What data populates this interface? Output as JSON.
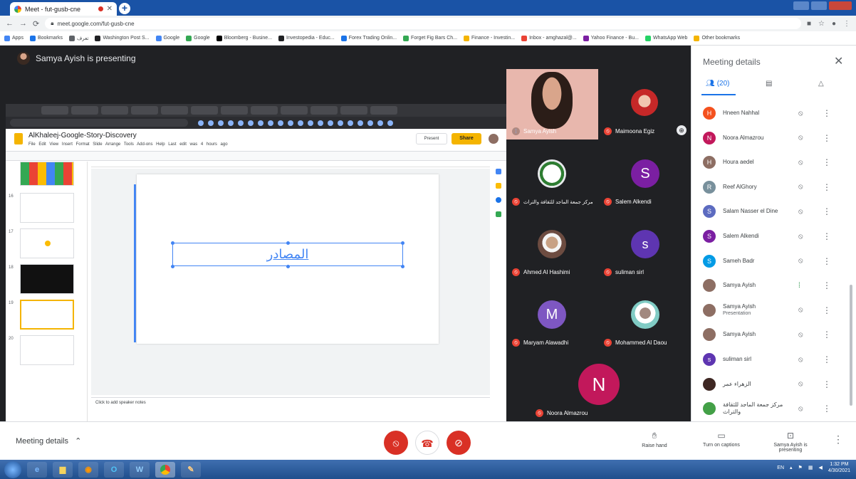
{
  "browser": {
    "tab_title": "Meet - fut-gusb-cne",
    "url": "meet.google.com/fut-gusb-cne",
    "bookmarks": [
      {
        "label": "Apps",
        "color": "#4285f4"
      },
      {
        "label": "Bookmarks",
        "color": "#1a73e8"
      },
      {
        "label": "تعرف",
        "color": "#5f6368"
      },
      {
        "label": "Washington Post S...",
        "color": "#202124"
      },
      {
        "label": "Google",
        "color": "#4285f4"
      },
      {
        "label": "Google",
        "color": "#34a853"
      },
      {
        "label": "Bloomberg - Busine...",
        "color": "#000000"
      },
      {
        "label": "Investopedia - Educ...",
        "color": "#202124"
      },
      {
        "label": "Forex Trading Onlin...",
        "color": "#1a73e8"
      },
      {
        "label": "Forget Fig Bars Ch...",
        "color": "#34a853"
      },
      {
        "label": "Finance - Investin...",
        "color": "#f4b400"
      },
      {
        "label": "Inbox - amghazal@...",
        "color": "#ea4335"
      },
      {
        "label": "Yahoo Finance - Bu...",
        "color": "#7b1fa2"
      },
      {
        "label": "WhatsApp Web",
        "color": "#25d366"
      },
      {
        "label": "Other bookmarks",
        "color": "#f4b400"
      }
    ]
  },
  "meet": {
    "presenting_label": "Samya Ayish is presenting",
    "shared_doc": {
      "title": "AlKhaleej-Google-Story-Discovery",
      "menu": "File  Edit  View  Insert  Format  Slide  Arrange  Tools  Add-ons  Help  Last edit was 4 hours ago",
      "present_label": "Present",
      "share_label": "Share",
      "slide_text": "المصادر",
      "notes_placeholder": "Click to add speaker notes",
      "slide_numbers": [
        "16",
        "17",
        "18",
        "19",
        "20"
      ]
    },
    "tiles": [
      {
        "name": "Samya Ayish",
        "type": "video"
      },
      {
        "name": "Maimoona Egiz",
        "type": "photo"
      },
      {
        "name": "مركز جمعة الماجد للثقافة والتراث",
        "type": "logo"
      },
      {
        "name": "Salem Alkendi",
        "type": "initial",
        "initial": "S",
        "color": "#7b1fa2"
      },
      {
        "name": "Ahmed Al Hashimi",
        "type": "photo"
      },
      {
        "name": "suliman sirl",
        "type": "initial",
        "initial": "s",
        "color": "#5e35b1"
      },
      {
        "name": "Maryam Alawadhi",
        "type": "initial",
        "initial": "M",
        "color": "#7e57c2"
      },
      {
        "name": "Mohammed Al Daou",
        "type": "photo"
      },
      {
        "name": "Noora Almazrou",
        "type": "initial",
        "initial": "N",
        "color": "#c2185b"
      }
    ]
  },
  "panel": {
    "title": "Meeting details",
    "people_tab_label": "(20)",
    "participants": [
      {
        "name": "Hneen Nahhal",
        "initial": "H",
        "color": "#f4511e"
      },
      {
        "name": "Noora Almazrou",
        "initial": "N",
        "color": "#c2185b"
      },
      {
        "name": "Houra aedel",
        "initial": "H",
        "color": "#8d6e63"
      },
      {
        "name": "Reef AlGhory",
        "initial": "R",
        "color": "#78909c"
      },
      {
        "name": "Salam Nasser el Dine",
        "initial": "S",
        "color": "#5c6bc0"
      },
      {
        "name": "Salem Alkendi",
        "initial": "S",
        "color": "#7b1fa2"
      },
      {
        "name": "Sameh Badr",
        "initial": "S",
        "color": "#039be5"
      },
      {
        "name": "Samya Ayish",
        "initial": "",
        "color": "#8d6e63"
      },
      {
        "name": "Samya Ayish",
        "subtitle": "Presentation",
        "initial": "",
        "color": "#8d6e63"
      },
      {
        "name": "Samya Ayish",
        "initial": "",
        "color": "#8d6e63"
      },
      {
        "name": "suliman sirl",
        "initial": "s",
        "color": "#5e35b1"
      },
      {
        "name": "الزهراء عمر",
        "initial": "",
        "color": "#3e2723"
      },
      {
        "name": "مركز جمعة الماجد للثقافة والتراث",
        "initial": "",
        "color": "#43a047"
      }
    ]
  },
  "bottom_bar": {
    "meeting_details": "Meeting details",
    "raise_hand": "Raise hand",
    "captions": "Turn on captions",
    "presenting": "Samya Ayish is presenting"
  },
  "taskbar": {
    "lang": "EN",
    "time": "1:32 PM",
    "date": "4/30/2021"
  }
}
